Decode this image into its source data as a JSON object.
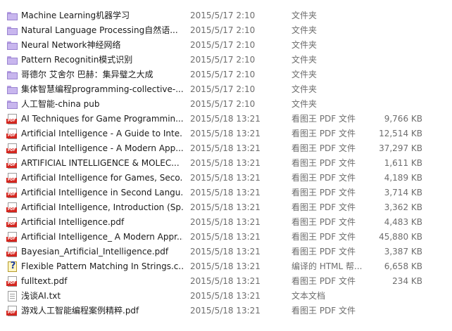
{
  "files": [
    {
      "name": "Machine Learning机器学习",
      "date": "2015/5/17 2:10",
      "type": "文件夹",
      "size": "",
      "icon": "folder-icon"
    },
    {
      "name": "Natural Language Processing自然语...",
      "date": "2015/5/17 2:10",
      "type": "文件夹",
      "size": "",
      "icon": "folder-icon"
    },
    {
      "name": "Neural Network神经网络",
      "date": "2015/5/17 2:10",
      "type": "文件夹",
      "size": "",
      "icon": "folder-icon"
    },
    {
      "name": "Pattern Recognitin模式识别",
      "date": "2015/5/17 2:10",
      "type": "文件夹",
      "size": "",
      "icon": "folder-icon"
    },
    {
      "name": "哥德尔 艾舍尔 巴赫：集异璧之大成",
      "date": "2015/5/17 2:10",
      "type": "文件夹",
      "size": "",
      "icon": "folder-icon"
    },
    {
      "name": "集体智慧编程programming-collective-...",
      "date": "2015/5/17 2:10",
      "type": "文件夹",
      "size": "",
      "icon": "folder-icon"
    },
    {
      "name": "人工智能-china pub",
      "date": "2015/5/17 2:10",
      "type": "文件夹",
      "size": "",
      "icon": "folder-icon"
    },
    {
      "name": "AI Techniques for Game Programmin...",
      "date": "2015/5/18 13:21",
      "type": "看图王 PDF 文件",
      "size": "9,766 KB",
      "icon": "pdf-icon"
    },
    {
      "name": "Artificial Intelligence - A Guide to Inte...",
      "date": "2015/5/18 13:21",
      "type": "看图王 PDF 文件",
      "size": "12,514 KB",
      "icon": "pdf-icon"
    },
    {
      "name": "Artificial Intelligence - A Modern App...",
      "date": "2015/5/18 13:21",
      "type": "看图王 PDF 文件",
      "size": "37,297 KB",
      "icon": "pdf-icon"
    },
    {
      "name": "ARTIFICIAL INTELLIGENCE & MOLEC...",
      "date": "2015/5/18 13:21",
      "type": "看图王 PDF 文件",
      "size": "1,611 KB",
      "icon": "pdf-icon"
    },
    {
      "name": "Artificial Intelligence for Games, Seco...",
      "date": "2015/5/18 13:21",
      "type": "看图王 PDF 文件",
      "size": "4,189 KB",
      "icon": "pdf-icon"
    },
    {
      "name": "Artificial Intelligence in Second Langu...",
      "date": "2015/5/18 13:21",
      "type": "看图王 PDF 文件",
      "size": "3,714 KB",
      "icon": "pdf-icon"
    },
    {
      "name": "Artificial Intelligence, Introduction (Sp...",
      "date": "2015/5/18 13:21",
      "type": "看图王 PDF 文件",
      "size": "3,362 KB",
      "icon": "pdf-icon"
    },
    {
      "name": "Artificial Intelligence.pdf",
      "date": "2015/5/18 13:21",
      "type": "看图王 PDF 文件",
      "size": "4,483 KB",
      "icon": "pdf-icon"
    },
    {
      "name": "Artificial Intelligence_ A Modern Appr...",
      "date": "2015/5/18 13:21",
      "type": "看图王 PDF 文件",
      "size": "45,880 KB",
      "icon": "pdf-icon"
    },
    {
      "name": "Bayesian_Artificial_Intelligence.pdf",
      "date": "2015/5/18 13:21",
      "type": "看图王 PDF 文件",
      "size": "3,387 KB",
      "icon": "pdf-icon"
    },
    {
      "name": "Flexible Pattern Matching In Strings.c...",
      "date": "2015/5/18 13:21",
      "type": "编译的 HTML 帮...",
      "size": "6,658 KB",
      "icon": "chm-help-icon"
    },
    {
      "name": "fulltext.pdf",
      "date": "2015/5/18 13:21",
      "type": "看图王 PDF 文件",
      "size": "234 KB",
      "icon": "pdf-icon"
    },
    {
      "name": "浅谈AI.txt",
      "date": "2015/5/18 13:21",
      "type": "文本文档",
      "size": "",
      "icon": "txt-icon"
    },
    {
      "name": "游戏人工智能编程案例精粹.pdf",
      "date": "2015/5/18 13:21",
      "type": "看图王 PDF 文件",
      "size": "",
      "icon": "pdf-icon"
    }
  ]
}
